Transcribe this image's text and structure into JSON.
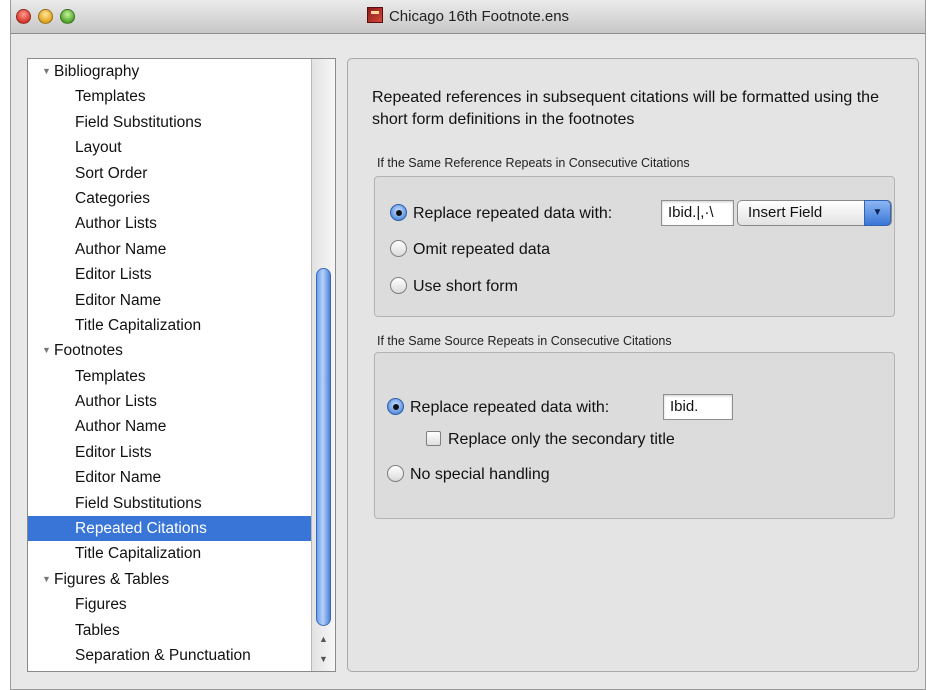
{
  "window": {
    "title": "Chicago 16th Footnote.ens"
  },
  "sidebar": {
    "rows": [
      {
        "label": "Bibliography",
        "kind": "group"
      },
      {
        "label": "Templates",
        "kind": "child"
      },
      {
        "label": "Field Substitutions",
        "kind": "child"
      },
      {
        "label": "Layout",
        "kind": "child"
      },
      {
        "label": "Sort Order",
        "kind": "child"
      },
      {
        "label": "Categories",
        "kind": "child"
      },
      {
        "label": "Author Lists",
        "kind": "child"
      },
      {
        "label": "Author Name",
        "kind": "child"
      },
      {
        "label": "Editor Lists",
        "kind": "child"
      },
      {
        "label": "Editor Name",
        "kind": "child"
      },
      {
        "label": "Title Capitalization",
        "kind": "child"
      },
      {
        "label": "Footnotes",
        "kind": "group"
      },
      {
        "label": "Templates",
        "kind": "child"
      },
      {
        "label": "Author Lists",
        "kind": "child"
      },
      {
        "label": "Author Name",
        "kind": "child"
      },
      {
        "label": "Editor Lists",
        "kind": "child"
      },
      {
        "label": "Editor Name",
        "kind": "child"
      },
      {
        "label": "Field Substitutions",
        "kind": "child"
      },
      {
        "label": "Repeated Citations",
        "kind": "child",
        "selected": true
      },
      {
        "label": "Title Capitalization",
        "kind": "child"
      },
      {
        "label": "Figures & Tables",
        "kind": "group"
      },
      {
        "label": "Figures",
        "kind": "child"
      },
      {
        "label": "Tables",
        "kind": "child"
      },
      {
        "label": "Separation & Punctuation",
        "kind": "child"
      }
    ]
  },
  "main": {
    "description": "Repeated references in subsequent citations will be formatted using the short form definitions in the footnotes",
    "section1": {
      "label": "If the Same Reference Repeats in Consecutive Citations",
      "replace_label": "Replace repeated data with:",
      "replace_value": "Ibid.|,·\\",
      "insert_field_label": "Insert Field",
      "omit_label": "Omit repeated data",
      "short_form_label": "Use short form",
      "selected": "replace"
    },
    "section2": {
      "label": "If the Same Source Repeats in Consecutive Citations",
      "replace_label": "Replace repeated data with:",
      "replace_value": "Ibid.",
      "secondary_label": "Replace only the secondary title",
      "secondary_checked": false,
      "no_special_label": "No special handling",
      "selected": "replace"
    }
  },
  "colors": {
    "selection": "#3875d7",
    "window_bg": "#e8e8e8"
  }
}
